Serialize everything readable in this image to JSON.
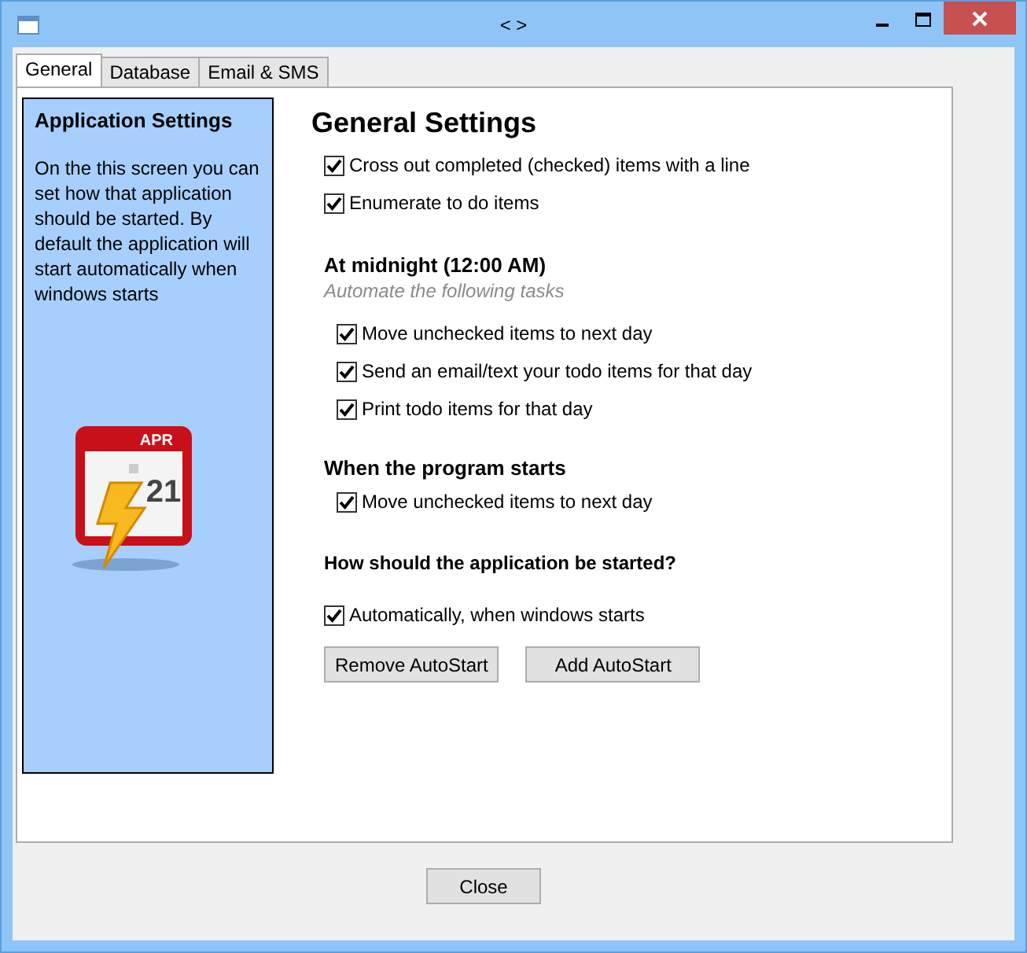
{
  "window": {
    "title": "< >"
  },
  "tabs": [
    {
      "label": "General",
      "selected": true
    },
    {
      "label": "Database",
      "selected": false
    },
    {
      "label": "Email & SMS",
      "selected": false
    }
  ],
  "sidebar": {
    "title": "Application Settings",
    "text": "On the this screen you can set how that application should be started. By default the application will start automatically when windows starts",
    "icon_month": "APR",
    "icon_day": "21"
  },
  "heading": "General Settings",
  "general_options": [
    {
      "label": "Cross out completed (checked) items with a line",
      "checked": true
    },
    {
      "label": "Enumerate to do items",
      "checked": true
    }
  ],
  "midnight": {
    "title": "At midnight (12:00 AM)",
    "subtitle": "Automate the following tasks",
    "options": [
      {
        "label": "Move unchecked items to next day",
        "checked": true
      },
      {
        "label": "Send an email/text your todo items for that day",
        "checked": true
      },
      {
        "label": "Print todo items for that day",
        "checked": true
      }
    ]
  },
  "startup": {
    "title": "When the program starts",
    "options": [
      {
        "label": "Move unchecked items to next day",
        "checked": true
      }
    ]
  },
  "autostart": {
    "title": "How should the application be started?",
    "options": [
      {
        "label": "Automatically, when windows starts",
        "checked": true
      }
    ],
    "buttons": [
      "Remove AutoStart",
      "Add AutoStart"
    ]
  },
  "close_button": "Close"
}
